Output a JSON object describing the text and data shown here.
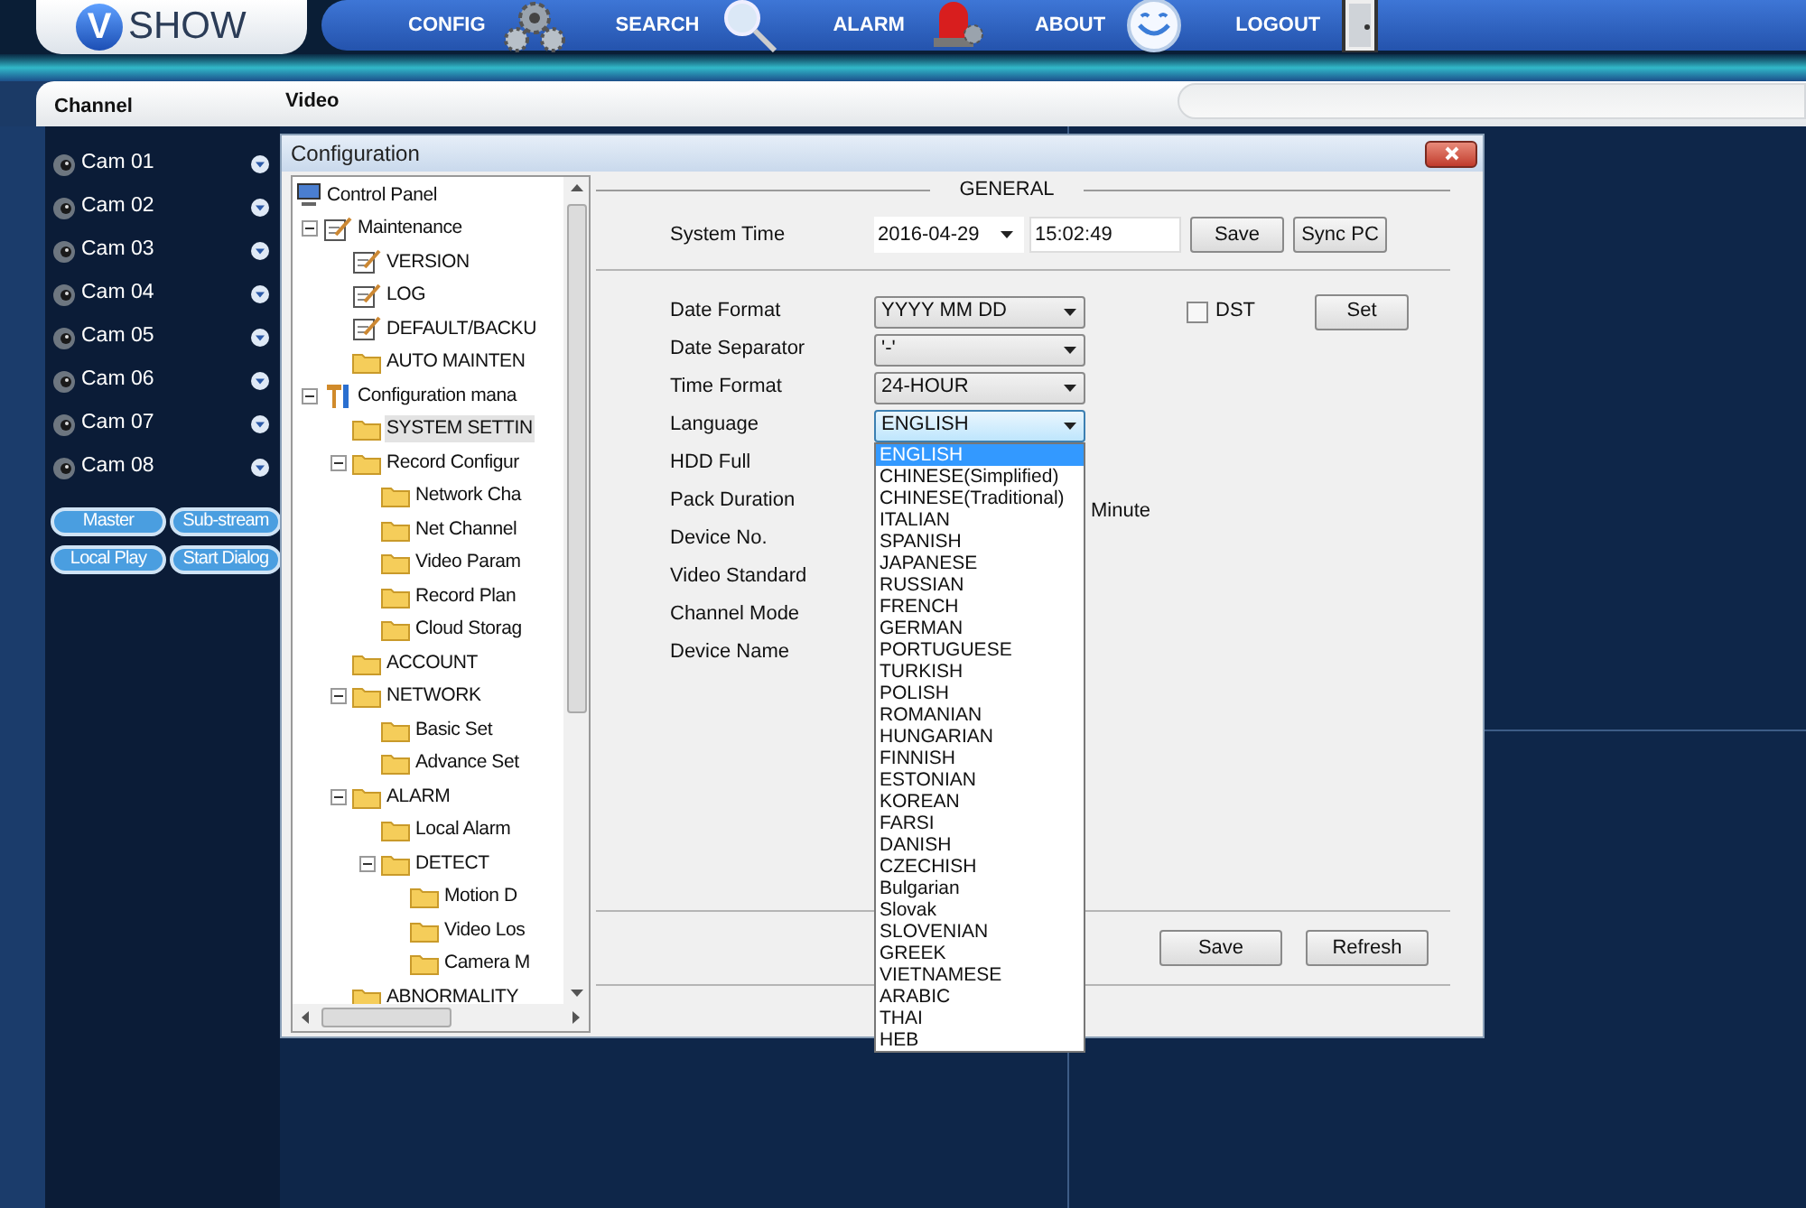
{
  "header": {
    "logo": {
      "letter": "V",
      "text": "SHOW"
    },
    "nav": [
      {
        "label": "CONFIG",
        "kind": "gears"
      },
      {
        "label": "SEARCH",
        "kind": "magnifier"
      },
      {
        "label": "ALARM",
        "kind": "siren"
      },
      {
        "label": "ABOUT",
        "kind": "smiley"
      },
      {
        "label": "LOGOUT",
        "kind": "door"
      }
    ]
  },
  "channel_panel": {
    "title": "Channel",
    "cameras": [
      "Cam 01",
      "Cam 02",
      "Cam 03",
      "Cam 04",
      "Cam 05",
      "Cam 06",
      "Cam 07",
      "Cam 08"
    ],
    "buttons": [
      "Master",
      "Sub-stream",
      "Local Play",
      "Start Dialog"
    ]
  },
  "video": {
    "title": "Video"
  },
  "dialog": {
    "title": "Configuration",
    "tree": [
      {
        "label": "Control Panel",
        "kind": "computer",
        "selected": false,
        "children": [
          {
            "label": "Maintenance",
            "kind": "edit",
            "selected": false,
            "expanded": true,
            "children": [
              {
                "label": "VERSION",
                "kind": "edit",
                "selected": false
              },
              {
                "label": "LOG",
                "kind": "edit",
                "selected": false
              },
              {
                "label": "DEFAULT/BACKU",
                "kind": "edit",
                "selected": false
              },
              {
                "label": "AUTO MAINTEN",
                "kind": "folder",
                "selected": false
              }
            ]
          },
          {
            "label": "Configuration mana",
            "kind": "tools",
            "selected": false,
            "expanded": true,
            "children": [
              {
                "label": "SYSTEM SETTIN",
                "kind": "folder",
                "selected": true
              },
              {
                "label": "Record Configur",
                "kind": "folder",
                "selected": false,
                "expanded": true,
                "children": [
                  {
                    "label": "Network Cha",
                    "kind": "folder",
                    "selected": false
                  },
                  {
                    "label": "Net Channel",
                    "kind": "folder",
                    "selected": false
                  },
                  {
                    "label": "Video Param",
                    "kind": "folder",
                    "selected": false
                  },
                  {
                    "label": "Record Plan",
                    "kind": "folder",
                    "selected": false
                  },
                  {
                    "label": "Cloud Storag",
                    "kind": "folder",
                    "selected": false
                  }
                ]
              },
              {
                "label": "ACCOUNT",
                "kind": "folder",
                "selected": false
              },
              {
                "label": "NETWORK",
                "kind": "folder",
                "selected": false,
                "expanded": true,
                "children": [
                  {
                    "label": "Basic Set",
                    "kind": "folder",
                    "selected": false
                  },
                  {
                    "label": "Advance Set",
                    "kind": "folder",
                    "selected": false
                  }
                ]
              },
              {
                "label": "ALARM",
                "kind": "folder",
                "selected": false,
                "expanded": true,
                "children": [
                  {
                    "label": "Local Alarm",
                    "kind": "folder",
                    "selected": false
                  },
                  {
                    "label": "DETECT",
                    "kind": "folder",
                    "selected": false,
                    "expanded": true,
                    "children": [
                      {
                        "label": "Motion D",
                        "kind": "folder",
                        "selected": false
                      },
                      {
                        "label": "Video Los",
                        "kind": "folder",
                        "selected": false
                      },
                      {
                        "label": "Camera M",
                        "kind": "folder",
                        "selected": false
                      }
                    ]
                  }
                ]
              },
              {
                "label": "ABNORMALITY",
                "kind": "folder",
                "selected": false
              }
            ]
          }
        ]
      }
    ],
    "form": {
      "section_title": "GENERAL",
      "system_time": {
        "label": "System Time",
        "date": "2016-04-29",
        "time": "15:02:49",
        "buttons": [
          "Save",
          "Sync PC"
        ]
      },
      "dst": {
        "label": "DST",
        "checked": false
      },
      "set_button": "Set",
      "fields": [
        {
          "label": "Date Format",
          "kind": "select",
          "value": "YYYY MM DD",
          "open": false
        },
        {
          "label": "Date Separator",
          "kind": "select",
          "value": "'-'",
          "open": false
        },
        {
          "label": "Time Format",
          "kind": "select",
          "value": "24-HOUR",
          "open": false
        },
        {
          "label": "Language",
          "kind": "select",
          "value": "ENGLISH",
          "open": true,
          "options": [
            {
              "label": "ENGLISH",
              "selected": true
            },
            {
              "label": "CHINESE(Simplified)",
              "selected": false
            },
            {
              "label": "CHINESE(Traditional)",
              "selected": false
            },
            {
              "label": "ITALIAN",
              "selected": false
            },
            {
              "label": "SPANISH",
              "selected": false
            },
            {
              "label": "JAPANESE",
              "selected": false
            },
            {
              "label": "RUSSIAN",
              "selected": false
            },
            {
              "label": "FRENCH",
              "selected": false
            },
            {
              "label": "GERMAN",
              "selected": false
            },
            {
              "label": "PORTUGUESE",
              "selected": false
            },
            {
              "label": "TURKISH",
              "selected": false
            },
            {
              "label": "POLISH",
              "selected": false
            },
            {
              "label": "ROMANIAN",
              "selected": false
            },
            {
              "label": "HUNGARIAN",
              "selected": false
            },
            {
              "label": "FINNISH",
              "selected": false
            },
            {
              "label": "ESTONIAN",
              "selected": false
            },
            {
              "label": "KOREAN",
              "selected": false
            },
            {
              "label": "FARSI",
              "selected": false
            },
            {
              "label": "DANISH",
              "selected": false
            },
            {
              "label": "CZECHISH",
              "selected": false
            },
            {
              "label": "Bulgarian",
              "selected": false
            },
            {
              "label": "Slovak",
              "selected": false
            },
            {
              "label": "SLOVENIAN",
              "selected": false
            },
            {
              "label": "GREEK",
              "selected": false
            },
            {
              "label": "VIETNAMESE",
              "selected": false
            },
            {
              "label": "ARABIC",
              "selected": false
            },
            {
              "label": "THAI",
              "selected": false
            },
            {
              "label": "HEB",
              "selected": false
            }
          ]
        },
        {
          "label": "HDD Full",
          "kind": "label"
        },
        {
          "label": "Pack Duration",
          "kind": "label",
          "unit": "Minute"
        },
        {
          "label": "Device No.",
          "kind": "label"
        },
        {
          "label": "Video Standard",
          "kind": "label"
        },
        {
          "label": "Channel Mode",
          "kind": "label"
        },
        {
          "label": "Device Name",
          "kind": "label"
        }
      ],
      "footer_buttons": [
        "Save",
        "Refresh"
      ]
    }
  }
}
